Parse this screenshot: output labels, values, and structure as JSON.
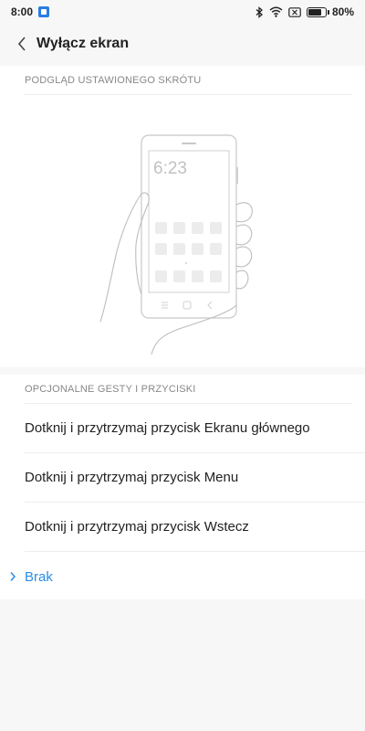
{
  "status_bar": {
    "time": "8:00",
    "battery_text": "80%",
    "battery_level": 0.8,
    "icons": [
      "bluetooth-icon",
      "wifi-icon",
      "no-sim-icon",
      "battery-icon"
    ]
  },
  "header": {
    "title": "Wyłącz ekran",
    "back_icon": "chevron-left-icon"
  },
  "preview": {
    "section_title": "PODGLĄD USTAWIONEGO SKRÓTU",
    "phone_time": "6:23"
  },
  "options": {
    "section_title": "OPCJONALNE GESTY I PRZYCISKI",
    "items": [
      {
        "label": "Dotknij i przytrzymaj przycisk Ekranu głównego",
        "selected": false
      },
      {
        "label": "Dotknij i przytrzymaj przycisk Menu",
        "selected": false
      },
      {
        "label": "Dotknij i przytrzymaj przycisk Wstecz",
        "selected": false
      },
      {
        "label": "Brak",
        "selected": true
      }
    ]
  },
  "colors": {
    "accent": "#2a8de8",
    "background": "#f7f7f7",
    "card": "#ffffff",
    "muted_text": "#888888"
  }
}
